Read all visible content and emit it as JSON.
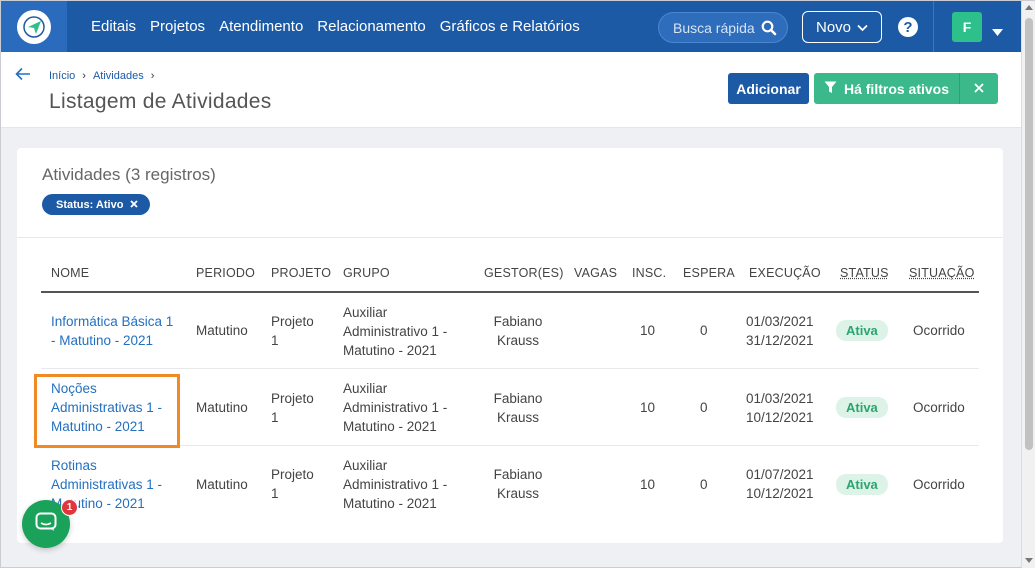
{
  "nav": {
    "links": [
      "Editais",
      "Projetos",
      "Atendimento",
      "Relacionamento",
      "Gráficos e Relatórios"
    ],
    "search_placeholder": "Busca rápida",
    "novo_label": "Novo",
    "avatar_initial": "F"
  },
  "breadcrumb": {
    "home": "Início",
    "current": "Atividades"
  },
  "page_title": "Listagem de Atividades",
  "actions": {
    "add_label": "Adicionar",
    "filters_label": "Há filtros ativos"
  },
  "card": {
    "title": "Atividades (3 registros)",
    "filter_chip": "Status: Ativo"
  },
  "table": {
    "headers": {
      "nome": "NOME",
      "periodo": "PERIODO",
      "projeto": "PROJETO",
      "grupo": "GRUPO",
      "gestor": "GESTOR(ES)",
      "vagas": "VAGAS",
      "insc": "INSC.",
      "espera": "ESPERA",
      "execucao": "EXECUÇÃO",
      "status": "STATUS",
      "situacao": "SITUAÇÃO"
    },
    "rows": [
      {
        "nome_1": "Informática Básica 1",
        "nome_2": "- Matutino - 2021",
        "nome_3": "",
        "periodo": "Matutino",
        "projeto_1": "Projeto",
        "projeto_2": "1",
        "grupo_1": "Auxiliar",
        "grupo_2": "Administrativo 1 -",
        "grupo_3": "Matutino - 2021",
        "gestor_1": "Fabiano",
        "gestor_2": "Krauss",
        "vagas": "",
        "insc": "10",
        "espera": "0",
        "exec_inicio": "01/03/2021",
        "exec_fim": "31/12/2021",
        "status": "Ativa",
        "situacao": "Ocorrido"
      },
      {
        "nome_1": "Noções",
        "nome_2": "Administrativas 1 -",
        "nome_3": "Matutino - 2021",
        "periodo": "Matutino",
        "projeto_1": "Projeto",
        "projeto_2": "1",
        "grupo_1": "Auxiliar",
        "grupo_2": "Administrativo 1 -",
        "grupo_3": "Matutino - 2021",
        "gestor_1": "Fabiano",
        "gestor_2": "Krauss",
        "vagas": "",
        "insc": "10",
        "espera": "0",
        "exec_inicio": "01/03/2021",
        "exec_fim": "10/12/2021",
        "status": "Ativa",
        "situacao": "Ocorrido"
      },
      {
        "nome_1": "Rotinas",
        "nome_2": "Administrativas 1 -",
        "nome_3": "Matutino - 2021",
        "periodo": "Matutino",
        "projeto_1": "Projeto",
        "projeto_2": "1",
        "grupo_1": "Auxiliar",
        "grupo_2": "Administrativo 1 -",
        "grupo_3": "Matutino - 2021",
        "gestor_1": "Fabiano",
        "gestor_2": "Krauss",
        "vagas": "",
        "insc": "10",
        "espera": "0",
        "exec_inicio": "01/07/2021",
        "exec_fim": "10/12/2021",
        "status": "Ativa",
        "situacao": "Ocorrido"
      }
    ]
  },
  "chat": {
    "unread_count": "1"
  },
  "colors": {
    "nav_bg": "#1d5aa6",
    "accent_green": "#3bb98a",
    "link": "#2470c0",
    "highlight": "#f08a24"
  }
}
